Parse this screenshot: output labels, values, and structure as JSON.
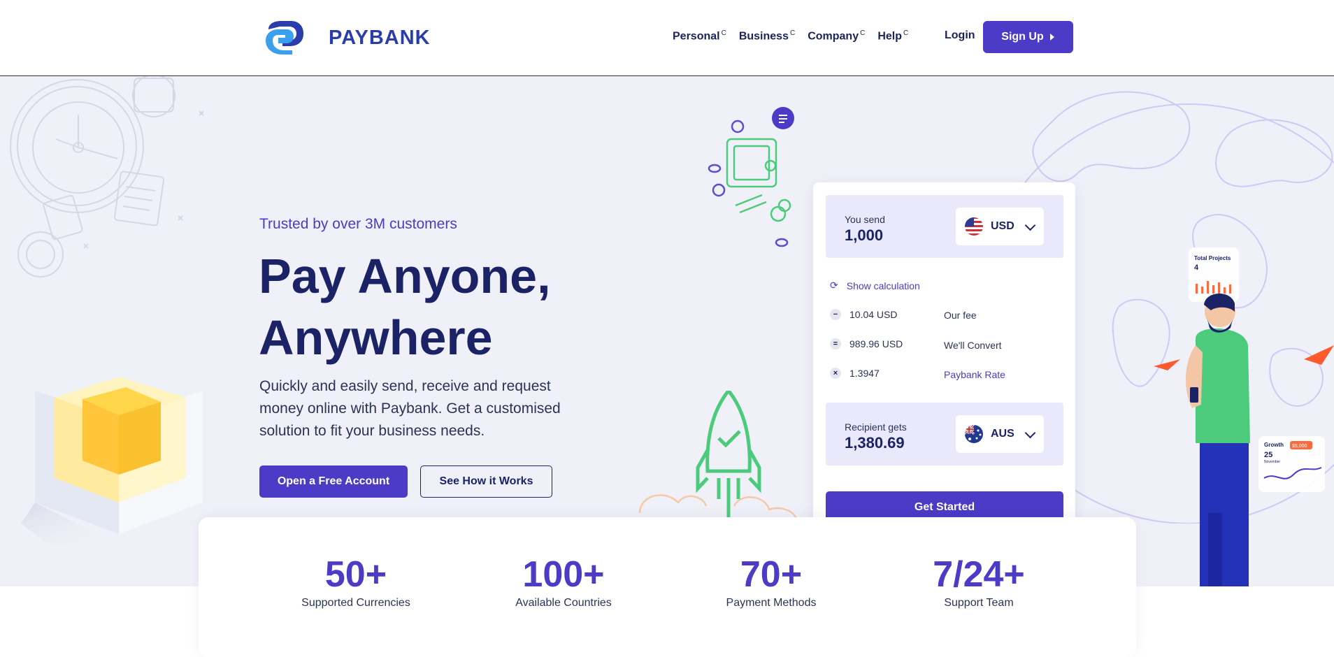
{
  "brand": {
    "name": "PAYBANK",
    "primary_color": "#4b3bc6",
    "dark_color": "#1b2366",
    "logo_icon": "paybank-logo-icon"
  },
  "nav": {
    "items": [
      {
        "label": "Personal",
        "marker": "C"
      },
      {
        "label": "Business",
        "marker": "C"
      },
      {
        "label": "Company",
        "marker": "C"
      },
      {
        "label": "Help",
        "marker": "C"
      }
    ],
    "login": "Login",
    "signup": "Sign Up"
  },
  "hero": {
    "eyebrow": "Trusted by over 3M customers",
    "headline_line1": "Pay Anyone,",
    "headline_line2": "Anywhere",
    "description": "Quickly and easily send, receive and request money online with Paybank. Get a customised solution to fit your business needs.",
    "primary_cta": "Open a Free Account",
    "secondary_cta": "See How it Works"
  },
  "converter": {
    "send_label": "You send",
    "send_value": "1,000",
    "send_currency": "USD",
    "show_calculation": "Show calculation",
    "rows": [
      {
        "icon": "−",
        "value": "10.04 USD",
        "label": "Our fee"
      },
      {
        "icon": "=",
        "value": "989.96 USD",
        "label": "We'll Convert"
      },
      {
        "icon": "×",
        "value": "1.3947",
        "label": "Paybank Rate"
      }
    ],
    "receive_label": "Recipient gets",
    "receive_value": "1,380.69",
    "receive_currency": "AUS",
    "cta": "Get Started"
  },
  "illustration": {
    "projects_title": "Total Projects",
    "projects_value": "4",
    "growth_title": "Growth",
    "growth_value": "25",
    "growth_month": "November",
    "growth_badge": "$5,000"
  },
  "stats": [
    {
      "value": "50+",
      "label": "Supported Currencies"
    },
    {
      "value": "100+",
      "label": "Available Countries"
    },
    {
      "value": "70+",
      "label": "Payment Methods"
    },
    {
      "value": "7/24+",
      "label": "Support Team"
    }
  ]
}
